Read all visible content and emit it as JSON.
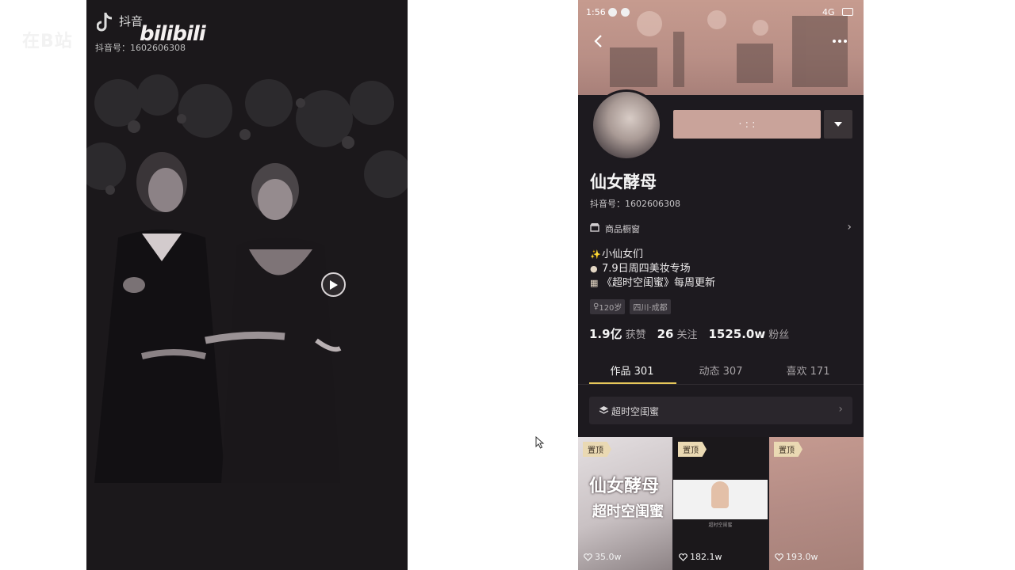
{
  "watermarks": {
    "douyin_text": "抖音",
    "douyin_id": "抖音号：1602606308",
    "left_text": "在B站",
    "bilibili_text": "bilibili"
  },
  "video": {
    "play_icon": "play-icon"
  },
  "phone": {
    "status": {
      "time": "1:56",
      "network": "4G"
    },
    "follow_label": "· : :",
    "profile": {
      "nickname": "仙女酵母",
      "douyin_id": "抖音号：1602606308",
      "shop_label": "商品橱窗",
      "bio": [
        {
          "icon": "✨",
          "text": "小仙女们"
        },
        {
          "icon": "●",
          "text": "7.9日周四美妆专场"
        },
        {
          "icon": "▦",
          "text": "《超时空闺蜜》每周更新"
        }
      ],
      "tags": [
        {
          "icon": "♀",
          "text": "120岁"
        },
        {
          "icon": "",
          "text": "四川·成都"
        }
      ],
      "stats": [
        {
          "value": "1.9亿",
          "label": "获赞"
        },
        {
          "value": "26",
          "label": "关注"
        },
        {
          "value": "1525.0w",
          "label": "粉丝"
        }
      ]
    },
    "tabs": [
      {
        "label": "作品 301",
        "active": true
      },
      {
        "label": "动态 307",
        "active": false
      },
      {
        "label": "喜欢 171",
        "active": false
      }
    ],
    "collection_label": "超时空闺蜜",
    "grid": [
      {
        "pin": "置顶",
        "likes": "35.0w",
        "title1": "仙女酵母",
        "title2": "超时空闺蜜"
      },
      {
        "pin": "置顶",
        "likes": "182.1w",
        "caption": "超时空闺蜜"
      },
      {
        "pin": "置顶",
        "likes": "193.0w"
      }
    ]
  },
  "colors": {
    "page_bg": "#ffffff",
    "video_bg": "#1b181b",
    "phone_bg": "#1d1a1f",
    "banner": "#c69b8f",
    "follow_button": "#c9a39a",
    "tab_underline": "#e7c85a",
    "pin_badge": "#ead9b3"
  }
}
